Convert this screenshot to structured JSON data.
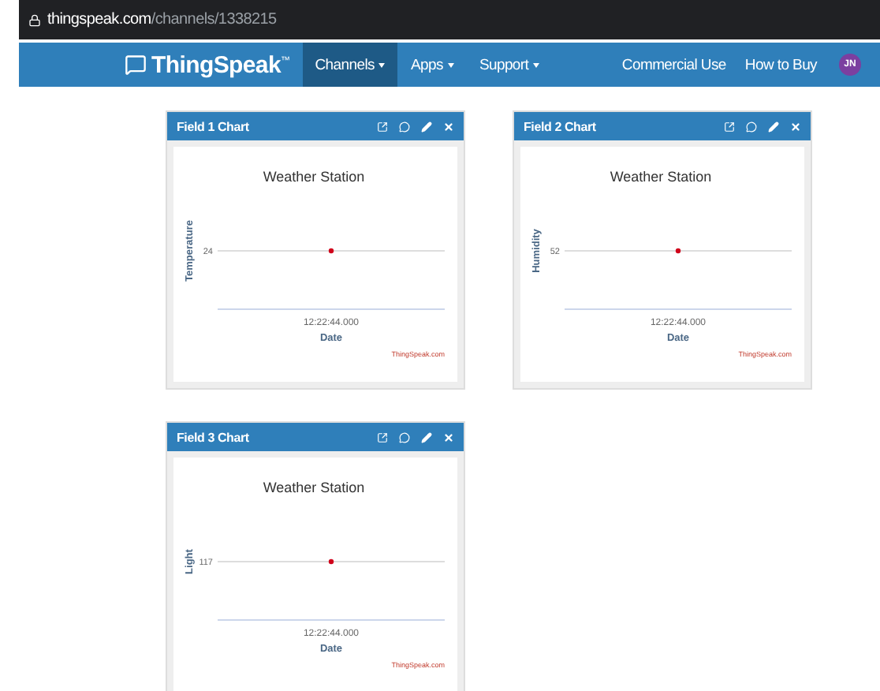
{
  "address_bar": {
    "host": "thingspeak.com",
    "path": "/channels/1338215"
  },
  "navbar": {
    "brand": "ThingSpeak",
    "trademark": "™",
    "items": [
      {
        "label": "Channels",
        "selected": true,
        "has_menu": true
      },
      {
        "label": "Apps",
        "selected": false,
        "has_menu": true
      },
      {
        "label": "Support",
        "selected": false,
        "has_menu": true
      }
    ],
    "right_links": [
      "Commercial Use",
      "How to Buy"
    ],
    "avatar": "JN"
  },
  "cards": [
    {
      "title": "Field 1 Chart",
      "credit": "ThingSpeak.com",
      "chart": {
        "title": "Weather Station",
        "ylabel": "Temperature",
        "y_value": "24",
        "x_value": "12:22:44.000",
        "xlabel": "Date"
      }
    },
    {
      "title": "Field 2 Chart",
      "credit": "ThingSpeak.com",
      "chart": {
        "title": "Weather Station",
        "ylabel": "Humidity",
        "y_value": "52",
        "x_value": "12:22:44.000",
        "xlabel": "Date"
      }
    },
    {
      "title": "Field 3 Chart",
      "credit": "ThingSpeak.com",
      "chart": {
        "title": "Weather Station",
        "ylabel": "Light",
        "y_value": "117",
        "x_value": "12:22:44.000",
        "xlabel": "Date"
      }
    }
  ]
}
